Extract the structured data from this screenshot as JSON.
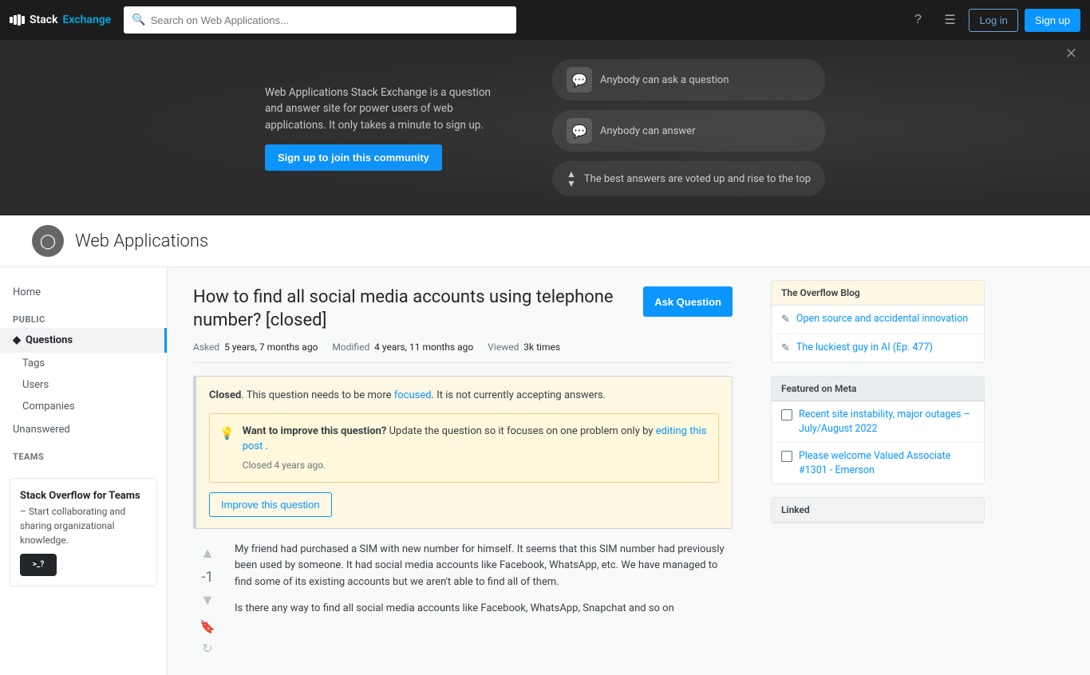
{
  "topnav": {
    "logo_stack": "Stack",
    "logo_exchange": "Exchange",
    "search_placeholder": "Search on Web Applications...",
    "login_label": "Log in",
    "signup_label": "Sign up"
  },
  "hero": {
    "description": "Web Applications Stack Exchange is a question and answer site for power users of web applications. It only takes a minute to sign up.",
    "cta_label": "Sign up to join this community",
    "bubble1": "Anybody can ask a question",
    "bubble2": "Anybody can answer",
    "vote_text": "The best answers are voted up and rise to the top"
  },
  "site_header": {
    "title": "Web Applications"
  },
  "sidebar": {
    "home_label": "Home",
    "public_label": "PUBLIC",
    "questions_label": "Questions",
    "tags_label": "Tags",
    "users_label": "Users",
    "companies_label": "Companies",
    "unanswered_label": "Unanswered",
    "teams_label": "TEAMS",
    "teams_title": "Stack Overflow for Teams",
    "teams_desc": "– Start collaborating and sharing organizational knowledge."
  },
  "question": {
    "title": "How to find all social media accounts using telephone number? [closed]",
    "ask_btn": "Ask Question",
    "meta_asked_label": "Asked",
    "meta_asked": "5 years, 7 months ago",
    "meta_modified_label": "Modified",
    "meta_modified": "4 years, 11 months ago",
    "meta_viewed_label": "Viewed",
    "meta_viewed": "3k times",
    "vote_count": "-1",
    "closed_notice": ". This question needs to be more ",
    "closed_label": "Closed",
    "focused_link": "focused",
    "closed_suffix": ". It is not currently accepting answers.",
    "improve_heading": "Want to improve this question?",
    "improve_desc": " Update the question so it focuses on one problem only by ",
    "editing_link": "editing this post",
    "improve_desc2": ".",
    "closed_note": "Closed 4 years ago.",
    "improve_btn": "Improve this question",
    "body_p1": "My friend had purchased a SIM with new number for himself. It seems that this SIM number had previously been used by someone. It had social media accounts like Facebook, WhatsApp, etc. We have managed to find some of its existing accounts but we aren't able to find all of them.",
    "body_p2": "Is there any way to find all social media accounts like Facebook, WhatsApp, Snapchat and so on"
  },
  "overflow_blog": {
    "header": "The Overflow Blog",
    "item1": "Open source and accidental innovation",
    "item2": "The luckiest guy in AI (Ep. 477)"
  },
  "featured_meta": {
    "header": "Featured on Meta",
    "item1": "Recent site instability, major outages – July/August 2022",
    "item2": "Please welcome Valued Associate #1301 - Emerson"
  },
  "linked": {
    "header": "Linked"
  }
}
